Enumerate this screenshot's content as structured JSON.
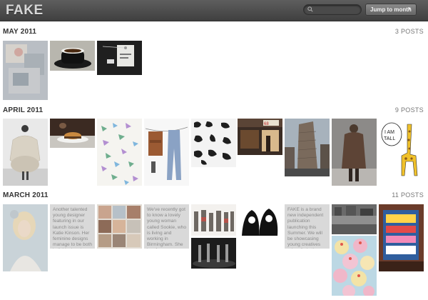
{
  "app": {
    "logo": "FAKE"
  },
  "search": {
    "placeholder": ""
  },
  "jump_menu": {
    "label": "Jump to month",
    "caret": "▼"
  },
  "sections": [
    {
      "month": "MAY 2011",
      "count": "3 POSTS",
      "thumbs": [
        "photo-collage",
        "coffee-cup",
        "tag-label"
      ]
    },
    {
      "month": "APRIL 2011",
      "count": "9 POSTS",
      "thumbs": [
        "white-sculptural-dress",
        "burger-plate",
        "bird-print-pattern",
        "clothes-on-line",
        "black-shapes-print",
        "cafe-storefront",
        "flatiron-building",
        "fur-coat-figure",
        "giraffe-illustration"
      ]
    },
    {
      "month": "MARCH 2011",
      "count": "11 POSTS",
      "thumbs": [
        "blonde-woman-portrait",
        "clothing-grid",
        "fashion-line-up",
        "dark-stage-performance",
        "black-white-illustration",
        "city-street-photo",
        "bakery-sign",
        "cupcakes"
      ],
      "text_posts": [
        "Another talented young designer featuring in our launch issue is Katie Kinson. Her feminine designs manage to be both individual and commercially",
        "We've recently got to know a lovely young woman called Sookie, who is living and working in Birmingham. She is a former engineer, current",
        "FAKE is a brand new independent publication launching this Summer. We will be showcasing young creatives primarily in the field of fashion; but also"
      ]
    }
  ]
}
